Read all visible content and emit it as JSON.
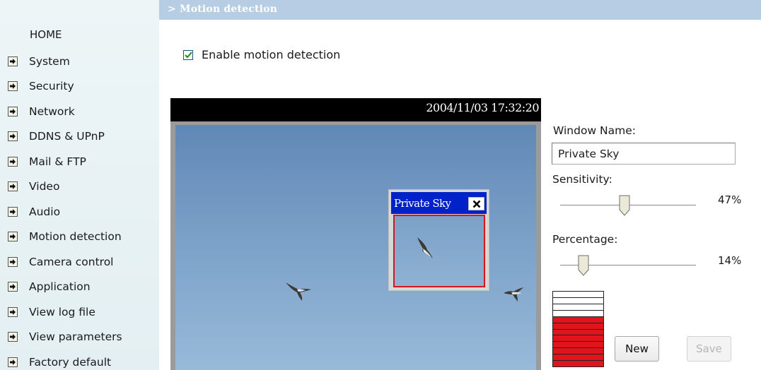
{
  "sidebar": {
    "home_label": "HOME",
    "items": [
      {
        "label": "System"
      },
      {
        "label": "Security"
      },
      {
        "label": "Network"
      },
      {
        "label": "DDNS & UPnP"
      },
      {
        "label": "Mail & FTP"
      },
      {
        "label": "Video"
      },
      {
        "label": "Audio"
      },
      {
        "label": "Motion detection"
      },
      {
        "label": "Camera control"
      },
      {
        "label": "Application"
      },
      {
        "label": "View log file"
      },
      {
        "label": "View parameters"
      },
      {
        "label": "Factory default"
      }
    ],
    "item_icon": "arrow-right-icon"
  },
  "header": {
    "title": "> Motion detection"
  },
  "enable_motion": {
    "label": "Enable motion detection",
    "checked": true
  },
  "video": {
    "timestamp": "2004/11/03 17:32:20"
  },
  "motion_window": {
    "title": "Private Sky",
    "close_icon": "close-icon"
  },
  "panel": {
    "window_name_label": "Window Name:",
    "window_name_value": "Private Sky",
    "sensitivity_label": "Sensitivity:",
    "sensitivity_value": 47,
    "sensitivity_display": "47%",
    "percentage_label": "Percentage:",
    "percentage_value": 14,
    "percentage_display": "14%",
    "level_meter": {
      "segments_total": 12,
      "segments_active": 8
    },
    "new_button": "New",
    "save_button": "Save",
    "save_enabled": false
  },
  "colors": {
    "header_bar": "#b7cde3",
    "sidebar_bg": "#e7f1f4",
    "motion_title_bg": "#0022c8",
    "motion_border": "#d8141e",
    "meter_active": "#e0141b"
  }
}
